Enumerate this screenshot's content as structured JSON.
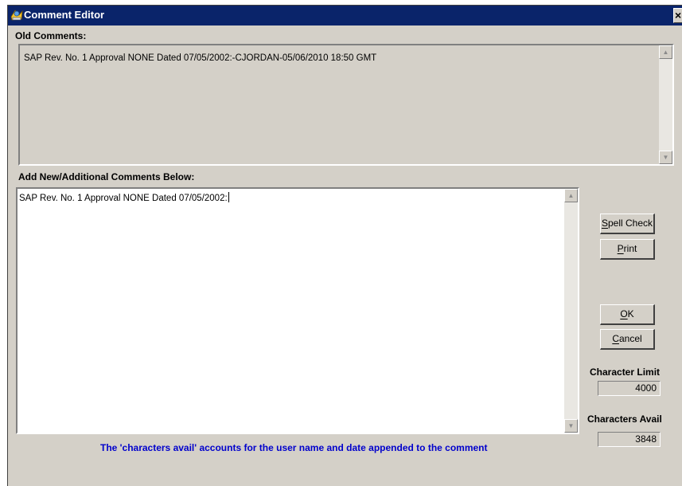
{
  "window": {
    "title": "Comment Editor",
    "close_glyph": "×"
  },
  "old_comments": {
    "label": "Old Comments:",
    "text": "SAP Rev. No. 1 Approval NONE Dated 07/05/2002:-CJORDAN-05/06/2010 18:50 GMT"
  },
  "new_comments": {
    "label": "Add New/Additional Comments Below:",
    "value": "SAP Rev. No. 1 Approval NONE Dated 07/05/2002:"
  },
  "buttons": {
    "spell_check": {
      "first": "S",
      "rest": "pell Check"
    },
    "print": {
      "first": "P",
      "rest": "rint"
    },
    "ok": {
      "first": "O",
      "rest": "K"
    },
    "cancel": {
      "first": "C",
      "rest": "ancel"
    }
  },
  "counters": {
    "character_limit_label": "Character Limit",
    "character_limit_value": "4000",
    "characters_avail_label": "Characters Avail",
    "characters_avail_value": "3848"
  },
  "footer_note": "The 'characters avail' accounts for the user name and date appended to the comment",
  "icons": {
    "app": "comment-editor-app-icon",
    "scroll_up": "scroll-up-arrow-icon",
    "scroll_down": "scroll-down-arrow-icon"
  },
  "colors": {
    "titlebar": "#0a246a",
    "dialog_face": "#d4d0c8",
    "footer_note": "#0000cc"
  }
}
